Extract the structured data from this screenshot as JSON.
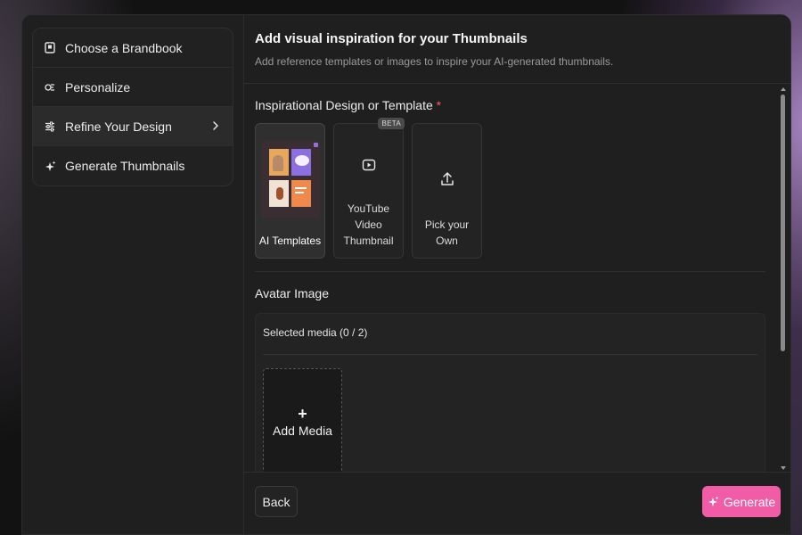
{
  "sidebar": {
    "steps": [
      {
        "label": "Choose a Brandbook",
        "icon": "brandbook-icon"
      },
      {
        "label": "Personalize",
        "icon": "personalize-icon"
      },
      {
        "label": "Refine Your Design",
        "icon": "sliders-icon",
        "active": true
      },
      {
        "label": "Generate Thumbnails",
        "icon": "sparkle-icon"
      }
    ]
  },
  "header": {
    "title": "Add visual inspiration for your Thumbnails",
    "subtitle": "Add reference templates or images to inspire your AI-generated thumbnails."
  },
  "inspiration": {
    "label": "Inspirational Design or Template",
    "required_mark": "*",
    "options": [
      {
        "label": "AI Templates",
        "selected": true
      },
      {
        "label": "YouTube Video Thumbnail",
        "badge": "BETA",
        "icon": "play-icon"
      },
      {
        "label": "Pick your Own",
        "icon": "upload-icon"
      }
    ]
  },
  "avatar": {
    "label": "Avatar Image",
    "selected_media": "Selected media (0 / 2)",
    "add_media_plus": "+",
    "add_media_label": "Add Media"
  },
  "footer": {
    "back_label": "Back",
    "generate_label": "Generate"
  },
  "colors": {
    "accent": "#f15ca6",
    "required": "#ff5a5a",
    "panel": "#1f1f1f"
  }
}
